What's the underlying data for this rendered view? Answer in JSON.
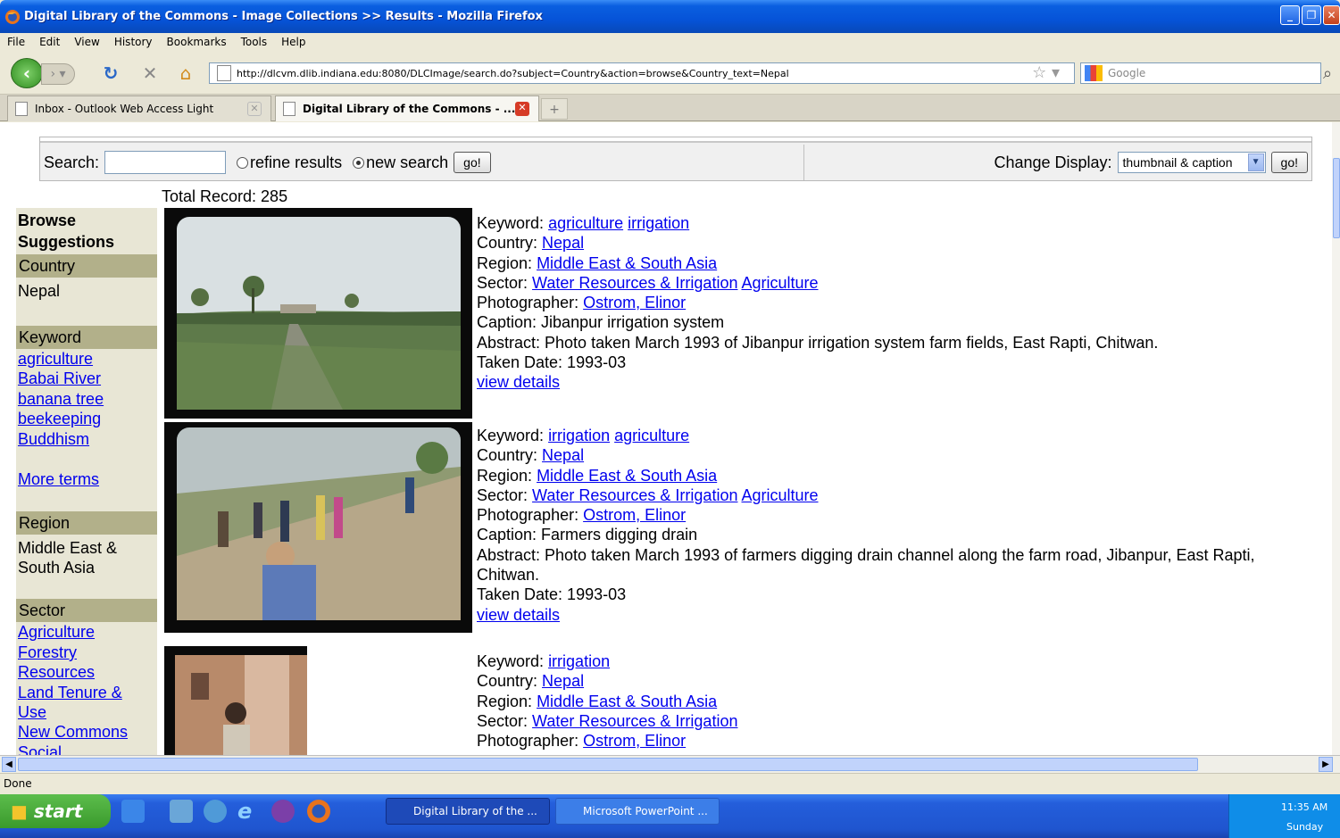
{
  "window": {
    "title": "Digital Library of the Commons - Image Collections >> Results - Mozilla Firefox"
  },
  "menu": [
    "File",
    "Edit",
    "View",
    "History",
    "Bookmarks",
    "Tools",
    "Help"
  ],
  "nav": {
    "url": "http://dlcvm.dlib.indiana.edu:8080/DLCImage/search.do?subject=Country&action=browse&Country_text=Nepal",
    "search_placeholder": "Google"
  },
  "tabs": [
    {
      "label": "Inbox - Outlook Web Access Light"
    },
    {
      "label": "Digital Library of the Commons - ..."
    }
  ],
  "search": {
    "label": "Search:",
    "value": "",
    "refine": "refine results",
    "new": "new search",
    "go": "go!",
    "change_display": "Change Display:",
    "display_value": "thumbnail & caption",
    "go2": "go!"
  },
  "total": "Total Record: 285",
  "sidebar": {
    "title": "Browse Suggestions",
    "country_label": "Country",
    "country_value": "Nepal",
    "keyword_label": "Keyword",
    "keywords": [
      "agriculture",
      "Babai River",
      "banana tree",
      "beekeeping",
      "Buddhism"
    ],
    "more": "More terms",
    "region_label": "Region",
    "region_value": "Middle East & South Asia",
    "sector_label": "Sector",
    "sectors": [
      "Agriculture",
      "Forestry Resources",
      "Land Tenure & Use",
      "New Commons",
      "Social"
    ]
  },
  "results": [
    {
      "keyword_label": "Keyword:",
      "keywords": [
        "agriculture",
        "irrigation"
      ],
      "country_label": "Country:",
      "country": "Nepal",
      "region_label": "Region:",
      "region": "Middle East & South Asia",
      "sector_label": "Sector:",
      "sectors": [
        "Water Resources & Irrigation",
        "Agriculture"
      ],
      "photographer_label": "Photographer:",
      "photographer": "Ostrom, Elinor",
      "caption": "Caption: Jibanpur irrigation system",
      "abstract": "Abstract: Photo taken March 1993 of Jibanpur irrigation system farm fields, East Rapti, Chitwan.",
      "date": "Taken Date: 1993-03",
      "details": "view details"
    },
    {
      "keyword_label": "Keyword:",
      "keywords": [
        "irrigation",
        "agriculture"
      ],
      "country_label": "Country:",
      "country": "Nepal",
      "region_label": "Region:",
      "region": "Middle East & South Asia",
      "sector_label": "Sector:",
      "sectors": [
        "Water Resources & Irrigation",
        "Agriculture"
      ],
      "photographer_label": "Photographer:",
      "photographer": "Ostrom, Elinor",
      "caption": "Caption: Farmers digging drain",
      "abstract": "Abstract: Photo taken March 1993 of farmers digging drain channel along the farm road, Jibanpur, East Rapti, Chitwan.",
      "date": "Taken Date: 1993-03",
      "details": "view details"
    },
    {
      "keyword_label": "Keyword:",
      "keywords": [
        "irrigation"
      ],
      "country_label": "Country:",
      "country": "Nepal",
      "region_label": "Region:",
      "region": "Middle East & South Asia",
      "sector_label": "Sector:",
      "sectors": [
        "Water Resources & Irrigation"
      ],
      "photographer_label": "Photographer:",
      "photographer": "Ostrom, Elinor"
    }
  ],
  "status": "Done",
  "taskbar": {
    "start": "start",
    "items": [
      "Digital Library of the ...",
      "Microsoft PowerPoint ..."
    ],
    "time": "11:35 AM",
    "day": "Sunday"
  }
}
